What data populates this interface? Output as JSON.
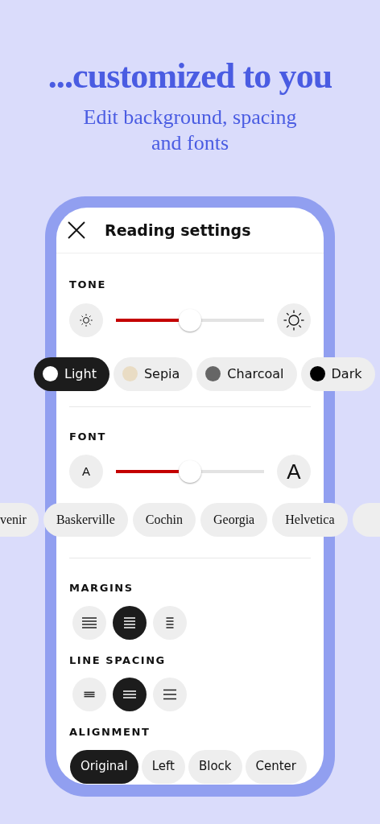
{
  "headline": "...customized to you",
  "subtitle": "Edit background, spacing and fonts",
  "header": {
    "title": "Reading settings"
  },
  "tone": {
    "label": "TONE",
    "level": 0.5,
    "options": [
      {
        "label": "Light",
        "color": "#ffffff",
        "selected": true
      },
      {
        "label": "Sepia",
        "color": "#e9dcc4",
        "selected": false
      },
      {
        "label": "Charcoal",
        "color": "#666666",
        "selected": false
      },
      {
        "label": "Dark",
        "color": "#000000",
        "selected": false
      }
    ]
  },
  "font": {
    "label": "FONT",
    "level": 0.5,
    "small_glyph": "A",
    "large_glyph": "A",
    "options": [
      {
        "label": "venir",
        "selected": false
      },
      {
        "label": "Baskerville",
        "selected": false
      },
      {
        "label": "Cochin",
        "selected": false
      },
      {
        "label": "Georgia",
        "selected": false
      },
      {
        "label": "Helvetica",
        "selected": false
      }
    ]
  },
  "margins": {
    "label": "MARGINS",
    "options": [
      {
        "kind": "wide",
        "selected": false
      },
      {
        "kind": "medium",
        "selected": true
      },
      {
        "kind": "narrow",
        "selected": false
      }
    ]
  },
  "line_spacing": {
    "label": "LINE SPACING",
    "options": [
      {
        "kind": "tight",
        "selected": false
      },
      {
        "kind": "medium",
        "selected": true
      },
      {
        "kind": "loose",
        "selected": false
      }
    ]
  },
  "alignment": {
    "label": "ALIGNMENT",
    "options": [
      {
        "label": "Original",
        "selected": true
      },
      {
        "label": "Left",
        "selected": false
      },
      {
        "label": "Block",
        "selected": false
      },
      {
        "label": "Center",
        "selected": false
      }
    ]
  }
}
